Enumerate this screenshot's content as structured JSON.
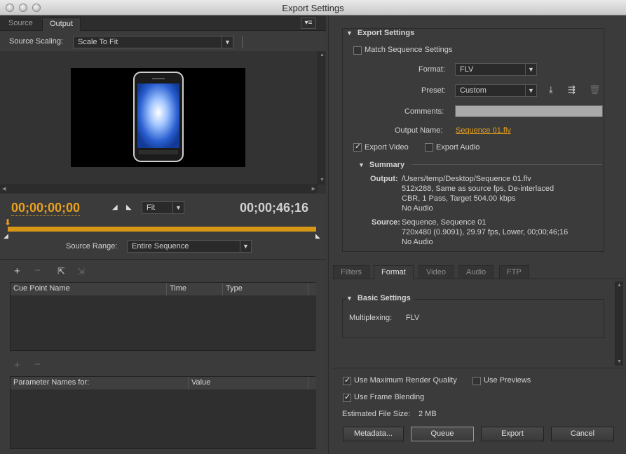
{
  "window": {
    "title": "Export Settings"
  },
  "left": {
    "tabs": [
      "Source",
      "Output"
    ],
    "source_scaling": {
      "label": "Source Scaling:",
      "value": "Scale To Fit"
    },
    "timecode_start": "00;00;00;00",
    "timecode_end": "00;00;46;16",
    "fit": "Fit",
    "source_range": {
      "label": "Source Range:",
      "value": "Entire Sequence"
    },
    "cue_table": {
      "headers": [
        "Cue Point Name",
        "Time",
        "Type"
      ]
    },
    "param_table": {
      "headers": [
        "Parameter Names for:",
        "Value"
      ]
    }
  },
  "right": {
    "export_settings_label": "Export Settings",
    "match_sequence": "Match Sequence Settings",
    "format": {
      "label": "Format:",
      "value": "FLV"
    },
    "preset": {
      "label": "Preset:",
      "value": "Custom"
    },
    "comments_label": "Comments:",
    "output_name": {
      "label": "Output Name:",
      "value": "Sequence 01.flv"
    },
    "export_video": "Export Video",
    "export_audio": "Export Audio",
    "summary": {
      "label": "Summary",
      "output_label": "Output:",
      "output_lines": [
        "/Users/temp/Desktop/Sequence 01.flv",
        "512x288, Same as source fps, De-interlaced",
        "CBR, 1 Pass, Target 504.00 kbps",
        "No Audio"
      ],
      "source_label": "Source:",
      "source_lines": [
        "Sequence, Sequence 01",
        "720x480 (0.9091), 29.97 fps, Lower, 00;00;46;16",
        "No Audio"
      ]
    },
    "tabs": [
      "Filters",
      "Format",
      "Video",
      "Audio",
      "FTP"
    ],
    "basic_settings": "Basic Settings",
    "multiplexing": {
      "label": "Multiplexing:",
      "value": "FLV"
    },
    "use_max_render": "Use Maximum Render Quality",
    "use_previews": "Use Previews",
    "use_frame_blending": "Use Frame Blending",
    "estimated_size": {
      "label": "Estimated File Size:",
      "value": "2 MB"
    },
    "buttons": {
      "metadata": "Metadata...",
      "queue": "Queue",
      "export": "Export",
      "cancel": "Cancel"
    }
  }
}
